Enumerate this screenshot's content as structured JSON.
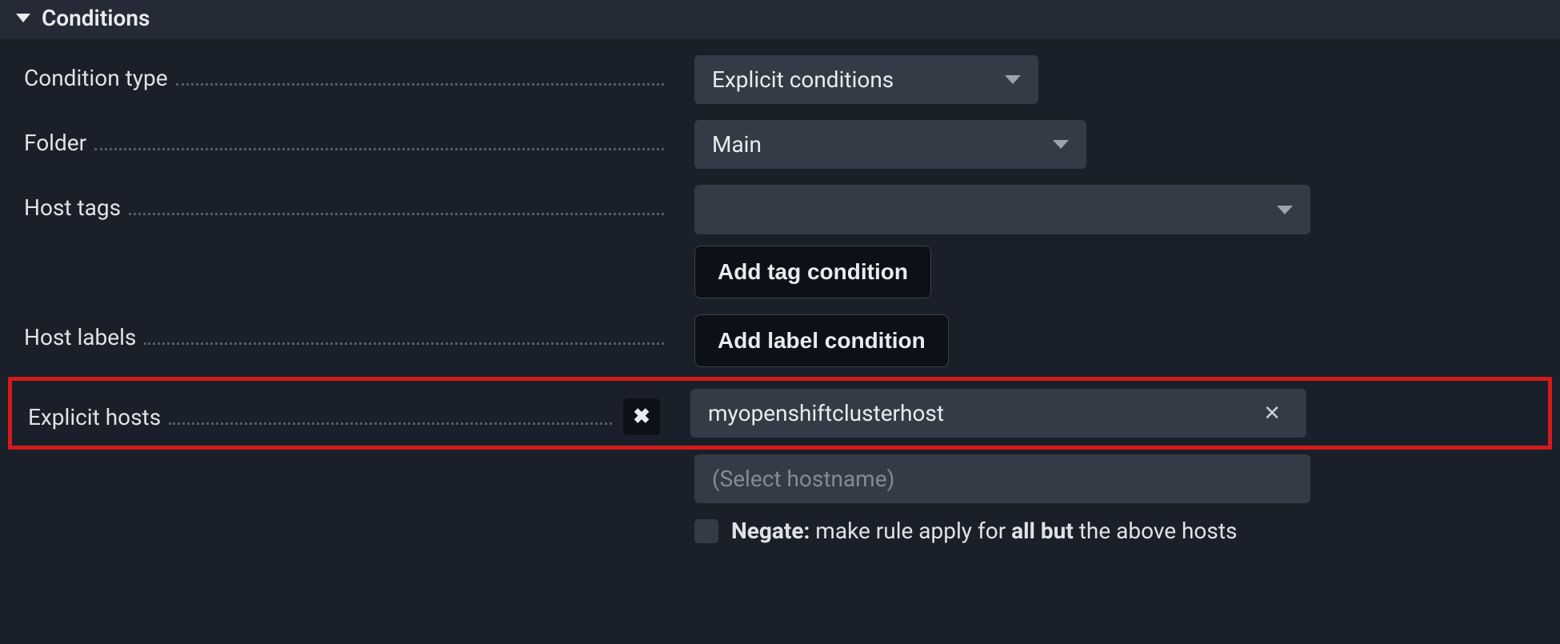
{
  "section": {
    "title": "Conditions"
  },
  "labels": {
    "condition_type": "Condition type",
    "folder": "Folder",
    "host_tags": "Host tags",
    "host_labels": "Host labels",
    "explicit_hosts": "Explicit hosts"
  },
  "values": {
    "condition_type_selected": "Explicit conditions",
    "folder_selected": "Main",
    "host_tags_selected": "",
    "add_tag_button": "Add tag condition",
    "add_label_button": "Add label condition",
    "explicit_host_value": "myopenshiftclusterhost",
    "hostname_placeholder": "(Select hostname)"
  },
  "negate": {
    "bold1": "Negate:",
    "text1": " make rule apply for ",
    "bold2": "all but",
    "text2": " the above hosts"
  }
}
